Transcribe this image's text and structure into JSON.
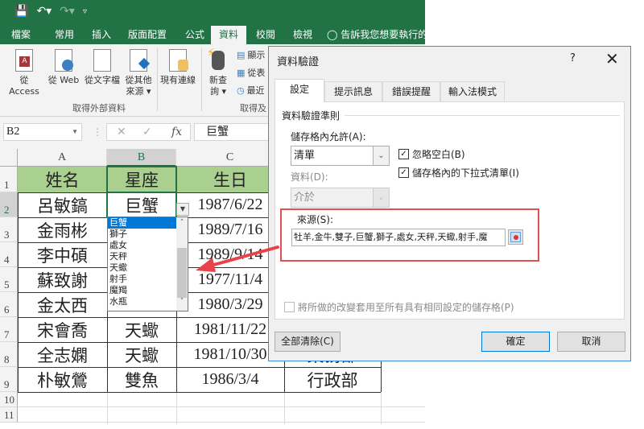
{
  "excel": {
    "quick_access": {
      "save_icon": "save-icon",
      "undo_icon": "undo-icon",
      "redo_icon": "redo-icon",
      "customize_icon": "customize-qat-icon"
    },
    "tabs": [
      "檔案",
      "常用",
      "插入",
      "版面配置",
      "公式",
      "資料",
      "校閱",
      "檢視"
    ],
    "active_tab": "資料",
    "tell_me": "告訴我您想要執行的",
    "ribbon": {
      "get_external": {
        "buttons": [
          "從 Access",
          "從 Web",
          "從文字檔",
          "從其他",
          "現有連線"
        ],
        "other_sub": "來源 ▾",
        "label": "取得外部資料"
      },
      "get_transform": {
        "new_query": "新查",
        "new_query_sub": "詢 ▾",
        "small_buttons": [
          "顯示",
          "從表",
          "最近"
        ],
        "label": "取得及"
      }
    },
    "formula_bar": {
      "name_box": "B2",
      "cancel_icon": "✕",
      "enter_icon": "✓",
      "fx_label": "fx",
      "value": "巨蟹"
    },
    "columns": [
      "A",
      "B",
      "C"
    ],
    "rows": [
      "1",
      "2",
      "3",
      "4",
      "5",
      "6",
      "7",
      "8",
      "9",
      "10",
      "11"
    ],
    "table": {
      "headers": [
        "姓名",
        "星座",
        "生日"
      ],
      "data": [
        [
          "呂敏鎬",
          "巨蟹",
          "1987/6/22",
          ""
        ],
        [
          "金雨彬",
          "",
          "1989/7/16",
          ""
        ],
        [
          "李中碩",
          "",
          "1989/9/14",
          ""
        ],
        [
          "蘇致謝",
          "",
          "1977/11/4",
          ""
        ],
        [
          "金太西",
          "",
          "1980/3/29",
          ""
        ],
        [
          "宋會喬",
          "天蠍",
          "1981/11/22",
          ""
        ],
        [
          "全志嫻",
          "天蠍",
          "1981/10/30",
          "業務部"
        ],
        [
          "朴敏鶯",
          "雙魚",
          "1986/3/4",
          "行政部"
        ]
      ]
    },
    "dropdown_list": {
      "items": [
        "巨蟹",
        "獅子",
        "處女",
        "天秤",
        "天蠍",
        "射手",
        "魔羯",
        "水瓶"
      ],
      "selected_index": 0
    }
  },
  "dialog": {
    "title": "資料驗證",
    "help": "?",
    "close": "✕",
    "tabs": [
      "設定",
      "提示訊息",
      "錯誤提醒",
      "輸入法模式"
    ],
    "active_tab": "設定",
    "section_label": "資料驗證準則",
    "allow_label": "儲存格內允許(A):",
    "allow_value": "清單",
    "data_label": "資料(D):",
    "data_value": "介於",
    "ignore_blank": {
      "label": "忽略空白(B)",
      "checked": true
    },
    "in_cell_dropdown": {
      "label": "儲存格內的下拉式清單(I)",
      "checked": true
    },
    "source_label": "來源(S):",
    "source_value": "牡羊,金牛,雙子,巨蟹,獅子,處女,天秤,天蠍,射手,魔",
    "apply_all": {
      "label": "將所做的改變套用至所有具有相同設定的儲存格(P)",
      "checked": false
    },
    "clear_all": "全部清除(C)",
    "ok": "確定",
    "cancel": "取消",
    "highlight_color": "#e05050"
  },
  "colors": {
    "excel_green": "#217346",
    "header_fill": "#a9d08e",
    "selection_blue": "#0078d7",
    "annotation_arrow": "#e8434c"
  }
}
